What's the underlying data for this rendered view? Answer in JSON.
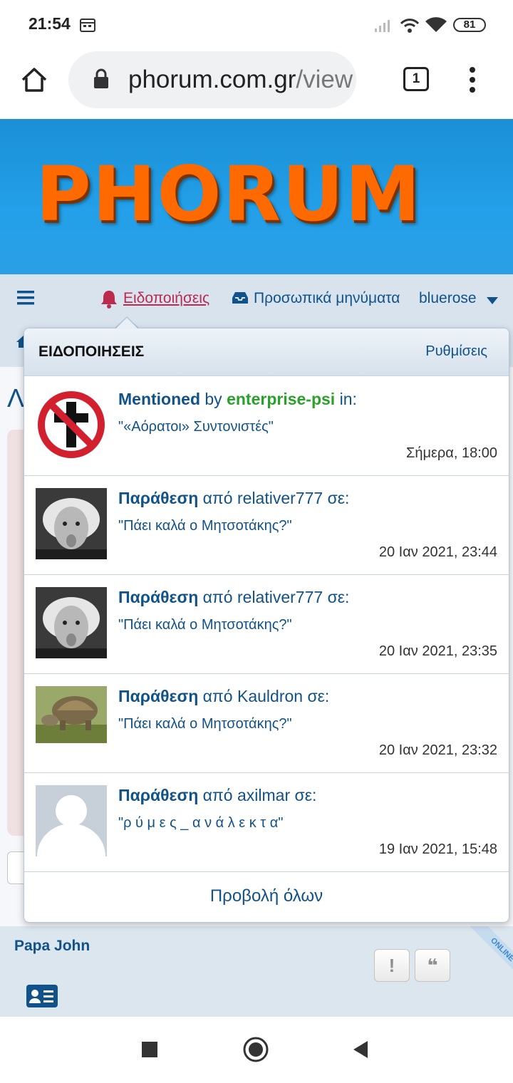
{
  "status_bar": {
    "time": "21:54",
    "battery": "81"
  },
  "browser": {
    "url_main": "phorum.com.gr",
    "url_rest": "/view",
    "tab_count": "1"
  },
  "header": {
    "logo": "PHORUM"
  },
  "navbar": {
    "notifications_label": "Ειδοποιήσεις",
    "messages_label": "Προσωπικά μηνύματα",
    "username": "bluerose"
  },
  "dropdown": {
    "title": "ΕΙΔΟΠΟΙΗΣΕΙΣ",
    "settings_label": "Ρυθμίσεις",
    "notifications": [
      {
        "prefix": "Mentioned",
        "connector": " by ",
        "user": "enterprise-psi",
        "suffix": " in:",
        "subject": "\"«Αόρατοι» Συντονιστές\"",
        "time": "Σήμερα, 18:00",
        "avatar": "no-cross-icon"
      },
      {
        "prefix": "Παράθεση",
        "connector": " από ",
        "user": "relativer777",
        "suffix": " σε:",
        "subject": "\"Πάει καλά ο Μητσοτάκης?\"",
        "time": "20 Ιαν 2021, 23:44",
        "avatar": "einstein-photo"
      },
      {
        "prefix": "Παράθεση",
        "connector": " από ",
        "user": "relativer777",
        "suffix": " σε:",
        "subject": "\"Πάει καλά ο Μητσοτάκης?\"",
        "time": "20 Ιαν 2021, 23:35",
        "avatar": "einstein-photo"
      },
      {
        "prefix": "Παράθεση",
        "connector": " από ",
        "user": "Kauldron",
        "suffix": " σε:",
        "subject": "\"Πάει καλά ο Μητσοτάκης?\"",
        "time": "20 Ιαν 2021, 23:32",
        "avatar": "tortoise-photo"
      },
      {
        "prefix": "Παράθεση",
        "connector": " από ",
        "user": "axilmar",
        "suffix": " σε:",
        "subject": "\"ρ ύ μ ε ς _ α ν ά λ ε κ τ α\"",
        "time": "19 Ιαν 2021, 15:48",
        "avatar": "default-avatar"
      }
    ],
    "view_all_label": "Προβολή όλων"
  },
  "post": {
    "author": "Papa John",
    "online_label": "ONLINE"
  },
  "colors": {
    "link": "#105289",
    "accent_notif": "#bc2a4d",
    "logo_orange": "#ff6a00",
    "banner_blue": "#23a0e9"
  }
}
